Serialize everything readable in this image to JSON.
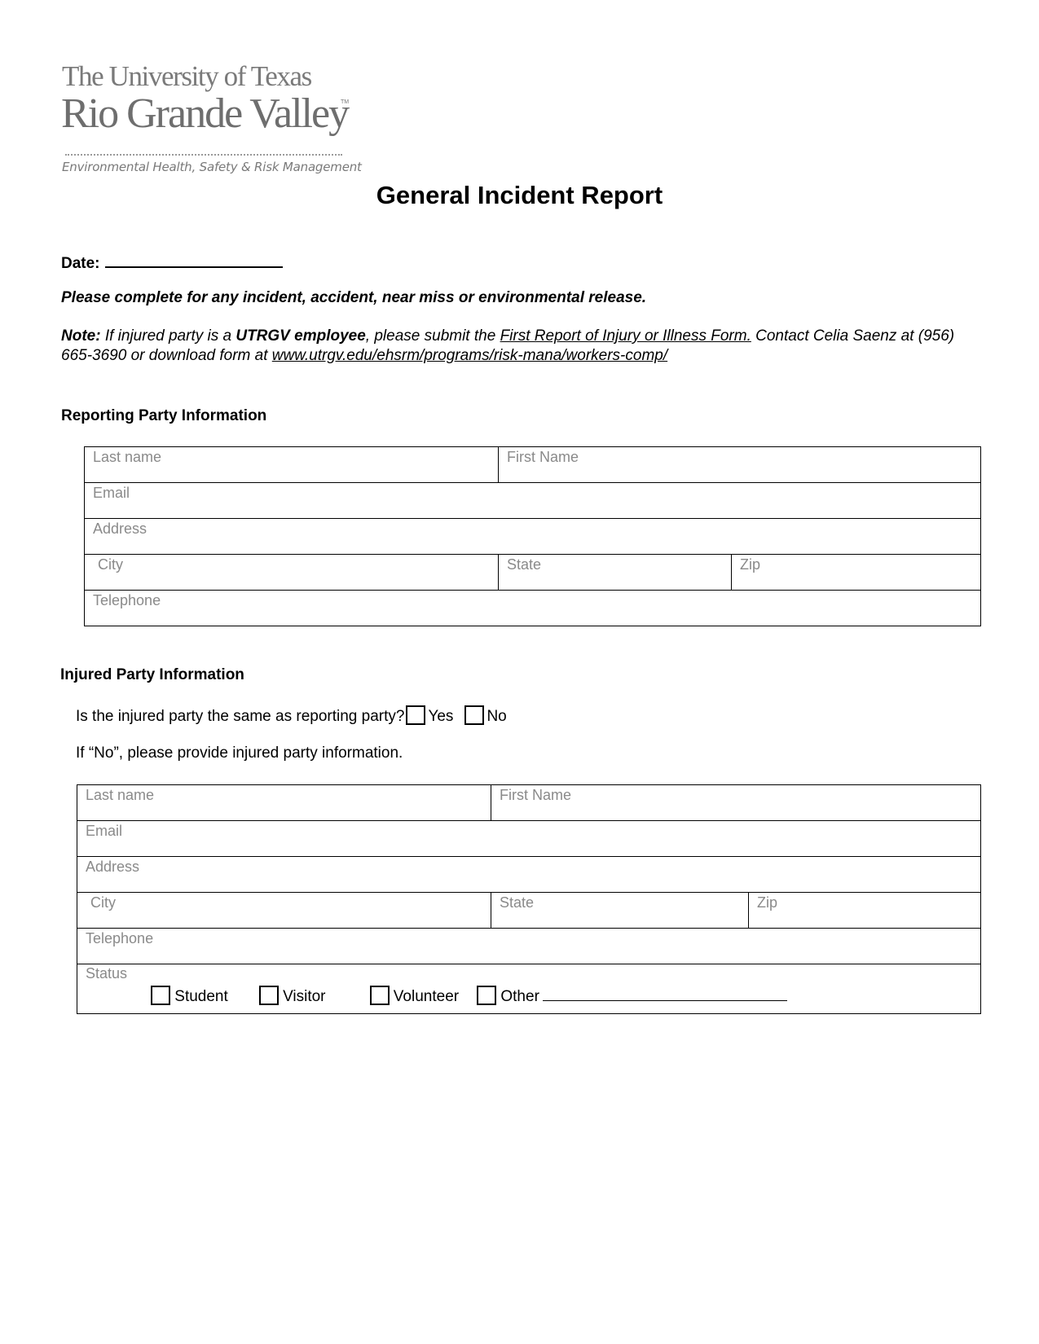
{
  "logo": {
    "line1": "The University of Texas",
    "line2": "Rio Grande Valley",
    "trademark": "TM",
    "tagline": "Environmental Health, Safety & Risk Management"
  },
  "title": "General Incident Report",
  "date": {
    "label": "Date:",
    "value": ""
  },
  "instruction": "Please complete for any incident, accident, near miss or environmental release.",
  "note": {
    "label": "Note:",
    "text1": " If injured party is a ",
    "bold": "UTRGV employee",
    "text2": ", please submit the ",
    "link_text": "First Report of Injury or Illness Form.",
    "text3": " Contact Celia Saenz at (956) 665-3690 or download form at ",
    "url_text": "www.utrgv.edu/ehsrm/programs/risk-mana/workers-comp/"
  },
  "reporting_party": {
    "heading": "Reporting Party Information",
    "fields": {
      "last_name": "Last name",
      "first_name": "First Name",
      "email": "Email",
      "address": "Address",
      "city": "City",
      "state": "State",
      "zip": "Zip",
      "telephone": "Telephone"
    }
  },
  "injured_party": {
    "heading": "Injured Party Information",
    "question": "Is the injured party the same as reporting party?",
    "yes_label": "Yes",
    "no_label": "No",
    "if_no": "If “No”, please provide injured party information.",
    "fields": {
      "last_name": "Last name",
      "first_name": "First Name",
      "email": "Email",
      "address": "Address",
      "city": "City",
      "state": "State",
      "zip": "Zip",
      "telephone": "Telephone",
      "status": "Status"
    },
    "status_options": [
      "Student",
      "Visitor",
      "Volunteer",
      "Other"
    ]
  }
}
